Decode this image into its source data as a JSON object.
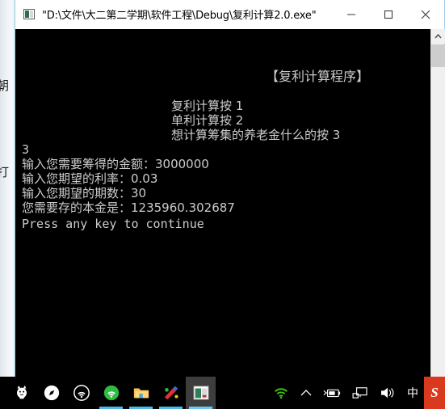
{
  "window": {
    "title": "\"D:\\文件\\大二第二学期\\软件工程\\Debug\\复利计算2.0.exe\"",
    "icon": "console-app-icon",
    "minimize_label": "最小化",
    "maximize_label": "最大化",
    "close_label": "关闭"
  },
  "console": {
    "program_title": "【复利计算程序】",
    "menu": [
      "复利计算按 1",
      "单利计算按 2",
      "想计算筹集的养老金什么的按 3"
    ],
    "echo_choice": "3",
    "prompts": {
      "amount": "输入您需要筹得的金额：3000000",
      "rate": "输入您期望的利率：0.03",
      "period": "输入您期望的期数：30",
      "result": "您需要存的本金是：1235960.302687"
    },
    "values": {
      "amount": "3000000",
      "rate": "0.03",
      "period": "30",
      "principal": "1235960.302687"
    },
    "press_any_key": "Press any key to continue",
    "text_color": "#cccccc",
    "background_color": "#000000"
  },
  "scrollbar": {
    "up_arrow": "scroll-up-arrow",
    "thumb_label": "scroll-thumb"
  },
  "desktop": {
    "bg_text_1": "朝",
    "bg_text_2": "打"
  },
  "taskbar": {
    "background_color": "#000000",
    "running_indicator_color": "#4db8e8",
    "items": [
      {
        "name": "cat-mascot-icon",
        "label": "桌面宠物",
        "running": false,
        "active": false
      },
      {
        "name": "compass-browser-icon",
        "label": "浏览器",
        "running": false,
        "active": false
      },
      {
        "name": "wifi-ring-icon",
        "label": "无线连接",
        "running": false,
        "active": false
      },
      {
        "name": "green-browser-icon",
        "label": "360浏览器",
        "running": true,
        "active": false
      },
      {
        "name": "file-explorer-icon",
        "label": "文件资源管理器",
        "running": true,
        "active": false
      },
      {
        "name": "paint-app-icon",
        "label": "绘图",
        "running": true,
        "active": false
      },
      {
        "name": "console-window-icon",
        "label": "复利计算2.0.exe",
        "running": true,
        "active": true
      }
    ],
    "tray": [
      {
        "name": "wifi-signal-icon",
        "label": "网络已连接",
        "color": "#3fd200"
      },
      {
        "name": "chevron-up-icon",
        "label": "显示隐藏的图标",
        "color": "#ffffff"
      },
      {
        "name": "battery-icon",
        "label": "电池",
        "color": "#ffffff"
      },
      {
        "name": "network-monitor-icon",
        "label": "网络",
        "color": "#ffffff"
      },
      {
        "name": "speaker-icon",
        "label": "音量",
        "color": "#ffffff"
      },
      {
        "name": "ime-mode-icon",
        "label": "中",
        "color": "#ffffff"
      },
      {
        "name": "sogou-ime-icon",
        "label": "S",
        "color": "#d93a1e"
      }
    ]
  }
}
